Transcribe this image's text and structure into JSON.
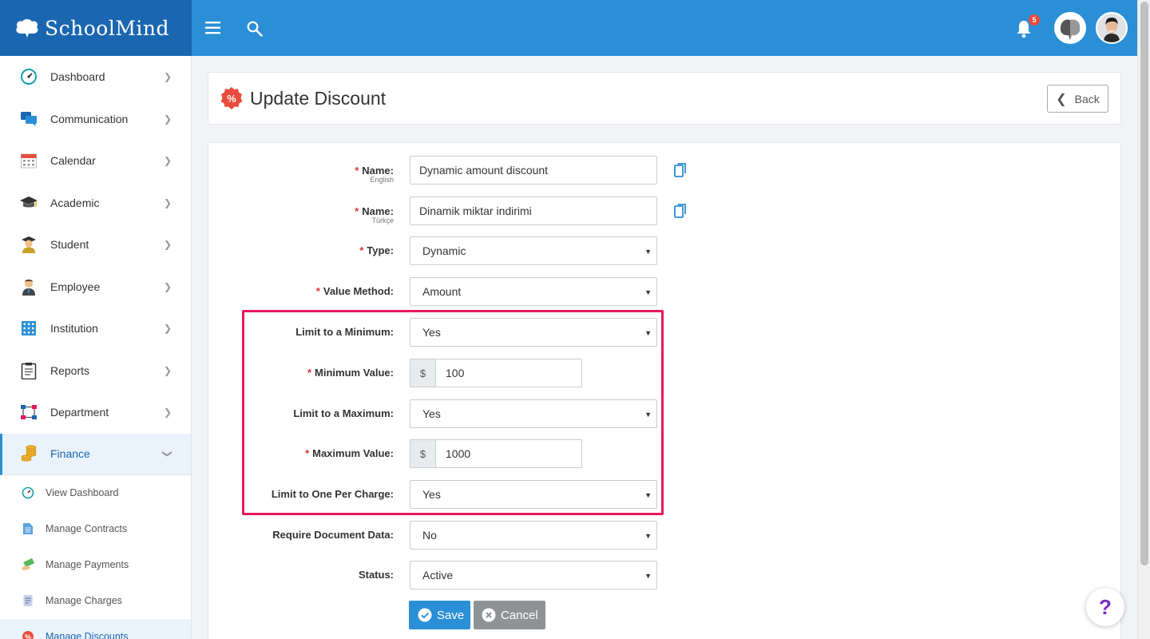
{
  "brand": {
    "name": "SchoolMind"
  },
  "topbar": {
    "notification_count": "5"
  },
  "sidebar": {
    "items": [
      {
        "label": "Dashboard"
      },
      {
        "label": "Communication"
      },
      {
        "label": "Calendar"
      },
      {
        "label": "Academic"
      },
      {
        "label": "Student"
      },
      {
        "label": "Employee"
      },
      {
        "label": "Institution"
      },
      {
        "label": "Reports"
      },
      {
        "label": "Department"
      },
      {
        "label": "Finance"
      }
    ],
    "finance_sub": [
      {
        "label": "View Dashboard"
      },
      {
        "label": "Manage Contracts"
      },
      {
        "label": "Manage Payments"
      },
      {
        "label": "Manage Charges"
      },
      {
        "label": "Manage Discounts"
      }
    ]
  },
  "header": {
    "title": "Update Discount",
    "back_label": "Back"
  },
  "form": {
    "name_en": {
      "label": "Name:",
      "sublabel": "English",
      "value": "Dynamic amount discount"
    },
    "name_tr": {
      "label": "Name:",
      "sublabel": "Türkçe",
      "value": "Dinamik miktar indirimi"
    },
    "type": {
      "label": "Type:",
      "value": "Dynamic"
    },
    "value_method": {
      "label": "Value Method:",
      "value": "Amount"
    },
    "limit_min": {
      "label": "Limit to a Minimum:",
      "value": "Yes"
    },
    "min_value": {
      "label": "Minimum Value:",
      "currency": "$",
      "value": "100"
    },
    "limit_max": {
      "label": "Limit to a Maximum:",
      "value": "Yes"
    },
    "max_value": {
      "label": "Maximum Value:",
      "currency": "$",
      "value": "1000"
    },
    "limit_one": {
      "label": "Limit to One Per Charge:",
      "value": "Yes"
    },
    "require_doc": {
      "label": "Require Document Data:",
      "value": "No"
    },
    "status": {
      "label": "Status:",
      "value": "Active"
    },
    "save_label": "Save",
    "cancel_label": "Cancel"
  },
  "help": {
    "label": "?"
  },
  "colors": {
    "brand_dark": "#1b66b1",
    "topbar": "#2a8fd6",
    "highlight": "#e8195c",
    "required": "#e03030"
  }
}
